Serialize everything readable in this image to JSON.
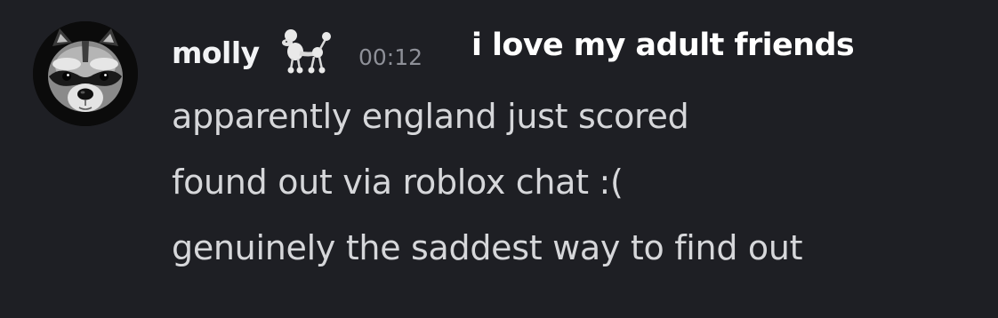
{
  "message": {
    "author": "molly",
    "author_decoration_icon": "poodle-icon",
    "timestamp": "00:12",
    "overlay_caption": "i love my adult friends",
    "avatar_icon": "raccoon-avatar",
    "lines": [
      "apparently england just scored",
      "found out via roblox chat :(",
      "genuinely the saddest way to find out"
    ]
  },
  "colors": {
    "background": "#1e1f24",
    "username": "#f2f3f5",
    "timestamp": "#8e9098",
    "message_text": "#d6d7da",
    "caption": "#ffffff"
  }
}
